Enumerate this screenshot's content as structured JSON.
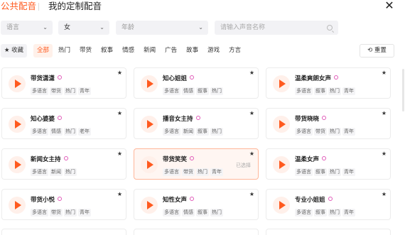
{
  "header": {
    "tab_public": "公共配音",
    "tab_mine": "我的定制配音",
    "close_label": "✕"
  },
  "filters": {
    "language": {
      "value": "语言"
    },
    "gender": {
      "value": "女"
    },
    "age": {
      "value": "年龄"
    },
    "search": {
      "placeholder": "请输入声音名称"
    }
  },
  "categories": {
    "favorites": "★ 收藏",
    "items": [
      "全部",
      "热门",
      "带货",
      "叙事",
      "情感",
      "新闻",
      "广告",
      "故事",
      "游戏",
      "方言"
    ],
    "active_index": 0,
    "reset_label": "重置",
    "reset_icon": "⟲"
  },
  "voices": [
    {
      "name": "带货潇潇",
      "tags": [
        "多语言",
        "带货",
        "热门",
        "青年"
      ],
      "selected": false
    },
    {
      "name": "知心姐姐",
      "tags": [
        "多语言",
        "情感",
        "叙事",
        "热门"
      ],
      "selected": false
    },
    {
      "name": "温柔爽朗女声",
      "tags": [
        "多语言",
        "叙事",
        "热门",
        "青年"
      ],
      "selected": false
    },
    {
      "name": "知心婆婆",
      "tags": [
        "多语言",
        "情感",
        "热门",
        "老年"
      ],
      "selected": false
    },
    {
      "name": "播音女主持",
      "tags": [
        "多语言",
        "新闻",
        "叙事",
        "热门"
      ],
      "selected": false
    },
    {
      "name": "带货晓晓",
      "tags": [
        "多语言",
        "带货",
        "热门",
        "青年"
      ],
      "selected": false
    },
    {
      "name": "新闻女主持",
      "tags": [
        "多语言",
        "新闻",
        "热门"
      ],
      "selected": false
    },
    {
      "name": "带货笑笑",
      "tags": [
        "多语言",
        "带货",
        "热门",
        "青年"
      ],
      "selected": true,
      "selected_label": "已选择"
    },
    {
      "name": "温柔女声",
      "tags": [
        "多语言",
        "叙事",
        "热门",
        "青年"
      ],
      "selected": false
    },
    {
      "name": "带货小悦",
      "tags": [
        "多语言",
        "带货",
        "热门",
        "青年"
      ],
      "selected": false
    },
    {
      "name": "知性女声",
      "tags": [
        "多语言",
        "情感",
        "叙事",
        "热门"
      ],
      "selected": false
    },
    {
      "name": "专业小姐姐",
      "tags": [
        "多语言",
        "叙事",
        "热门",
        "青年"
      ],
      "selected": false
    }
  ],
  "icons": {
    "play": "play-icon",
    "star": "★",
    "vip": "vip-icon"
  },
  "colors": {
    "accent": "#ff5a1f",
    "selected_bg": "#fff6f2",
    "selected_border": "#ffb79a"
  }
}
